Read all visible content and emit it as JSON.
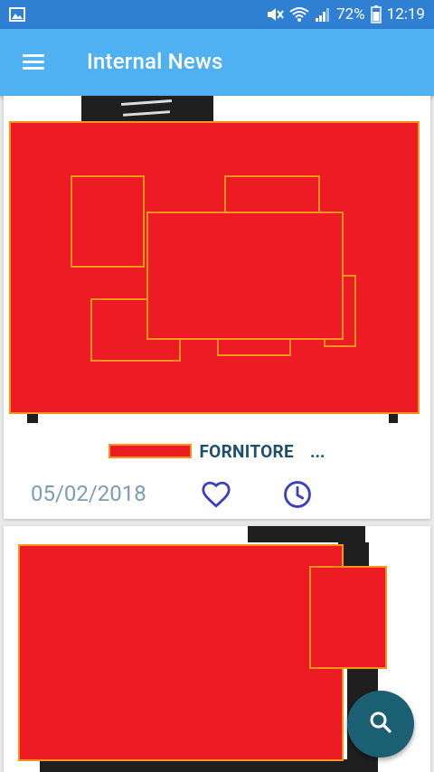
{
  "status_bar": {
    "battery": "72%",
    "time": "12:19"
  },
  "app_bar": {
    "title": "Internal News",
    "menu_icon": "hamburger-menu-icon"
  },
  "cards": [
    {
      "caption": "FORNITORE",
      "caption_more": "...",
      "date": "05/02/2018",
      "favorite_icon": "heart-outline-icon",
      "later_icon": "clock-icon"
    },
    {
      "caption": "",
      "date": ""
    }
  ],
  "fab": {
    "icon": "search-icon"
  },
  "colors": {
    "status_bar": "#2f7fd3",
    "app_bar": "#4fb0f2",
    "accent_icons": "#3a3fc2",
    "date_text": "#7a9fb3",
    "caption_text": "#1b4f6b",
    "fab": "#1b5f73",
    "redaction_fill": "#ed1c24",
    "redaction_border": "#f7941d"
  }
}
